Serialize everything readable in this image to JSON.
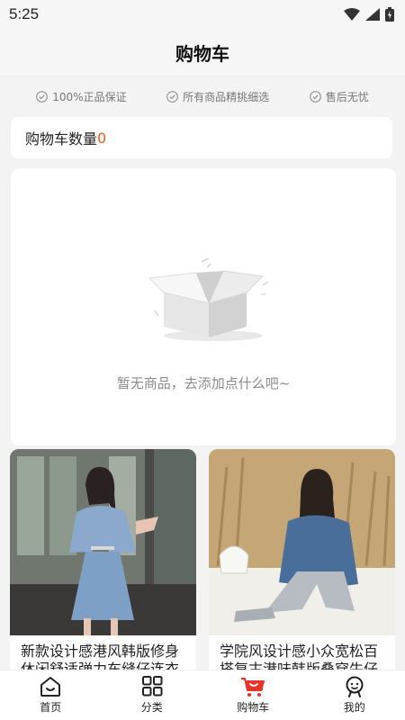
{
  "status_bar": {
    "time": "5:25"
  },
  "header": {
    "title": "购物车"
  },
  "guarantees": [
    {
      "label": "100%正品保证",
      "icon": "check-circle-icon"
    },
    {
      "label": "所有商品精挑细选",
      "icon": "check-circle-icon"
    },
    {
      "label": "售后无忧",
      "icon": "check-circle-icon"
    }
  ],
  "cart": {
    "count_label": "购物车数量",
    "count": "0"
  },
  "empty_state": {
    "icon": "empty-box-icon",
    "text": "暂无商品，去添加点什么吧~"
  },
  "products": [
    {
      "title": "新款设计感港风韩版修身休闲舒适弹力车缝仔连衣裙",
      "image": "denim-dress-photo"
    },
    {
      "title": "学院风设计感小众宽松百搭复古港味韩版叠穿牛仔外套",
      "image": "denim-jacket-photo"
    }
  ],
  "tabbar": {
    "active": "cart",
    "tabs": [
      {
        "id": "home",
        "label": "首页",
        "icon": "home-icon"
      },
      {
        "id": "category",
        "label": "分类",
        "icon": "grid-icon"
      },
      {
        "id": "cart",
        "label": "购物车",
        "icon": "cart-icon"
      },
      {
        "id": "mine",
        "label": "我的",
        "icon": "profile-icon"
      }
    ]
  },
  "colors": {
    "accent": "#f25a1d",
    "background": "#f3f3f3",
    "muted_text": "#8a8a8a"
  }
}
